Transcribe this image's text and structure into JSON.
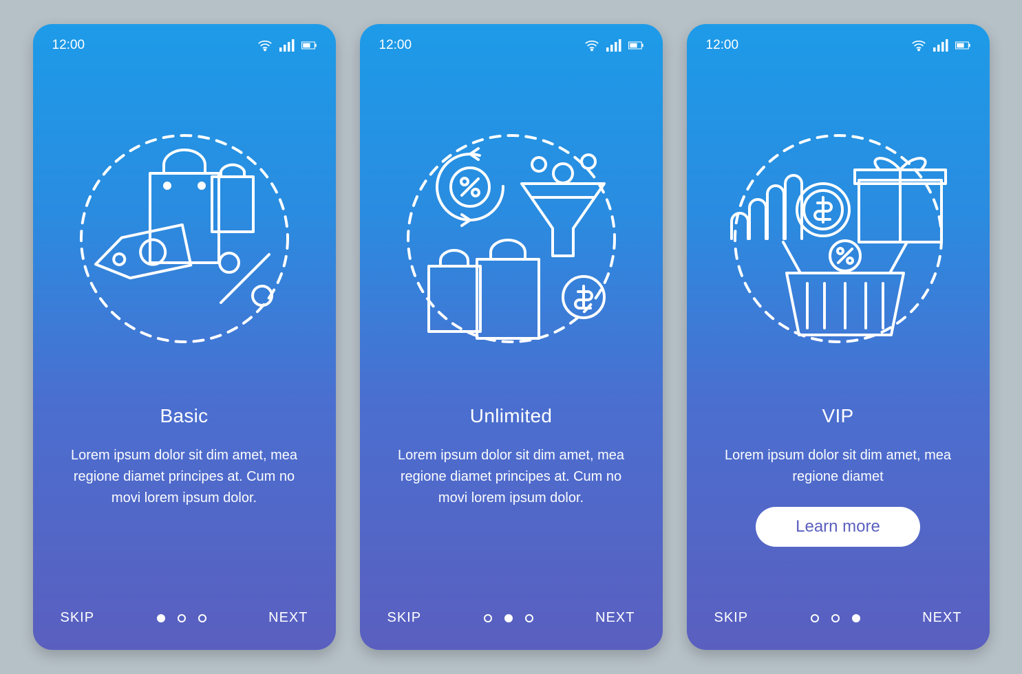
{
  "status": {
    "time": "12:00"
  },
  "screens": [
    {
      "title": "Basic",
      "desc": "Lorem ipsum dolor sit dim amet, mea regione diamet principes at. Cum no movi lorem ipsum dolor.",
      "skip": "SKIP",
      "next": "NEXT",
      "activeDot": 0,
      "hasCta": false
    },
    {
      "title": "Unlimited",
      "desc": "Lorem ipsum dolor sit dim amet, mea regione diamet principes at. Cum no movi lorem ipsum dolor.",
      "skip": "SKIP",
      "next": "NEXT",
      "activeDot": 1,
      "hasCta": false
    },
    {
      "title": "VIP",
      "desc": "Lorem ipsum dolor sit dim amet, mea regione diamet",
      "skip": "SKIP",
      "next": "NEXT",
      "activeDot": 2,
      "hasCta": true,
      "ctaLabel": "Learn more"
    }
  ]
}
